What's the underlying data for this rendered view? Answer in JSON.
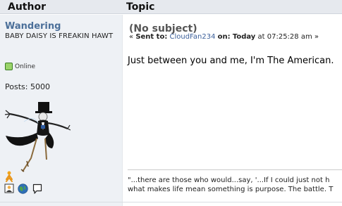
{
  "header": {
    "author_label": "Author",
    "topic_label": "Topic"
  },
  "author": {
    "name": "Wandering",
    "title": "BABY DAISY IS FREAKIN HAWT",
    "status": "Online",
    "posts": "Posts: 5000",
    "status_color": "#9ad36a"
  },
  "message": {
    "subject": "(No subject)",
    "prefix": "«",
    "sent_to_label": "Sent to:",
    "recipient": "CloudFan234",
    "on_label": "on:",
    "date": "Today",
    "time": "at 07:25:28 am »",
    "body": "Just between you and me, I'm The American.",
    "signature_line1": "\"...there are those who would...say, '...If I could just not h",
    "signature_line2": "what makes life mean something is purpose.  The battle. T"
  },
  "colors": {
    "header_bg": "#e6e9ee",
    "author_bg": "#eef1f5",
    "username": "#4b6f99",
    "link": "#3b5f9a"
  },
  "icons": [
    "online-status-icon",
    "avatar-image",
    "aim-icon",
    "profile-icon",
    "website-globe-icon",
    "message-icon"
  ]
}
